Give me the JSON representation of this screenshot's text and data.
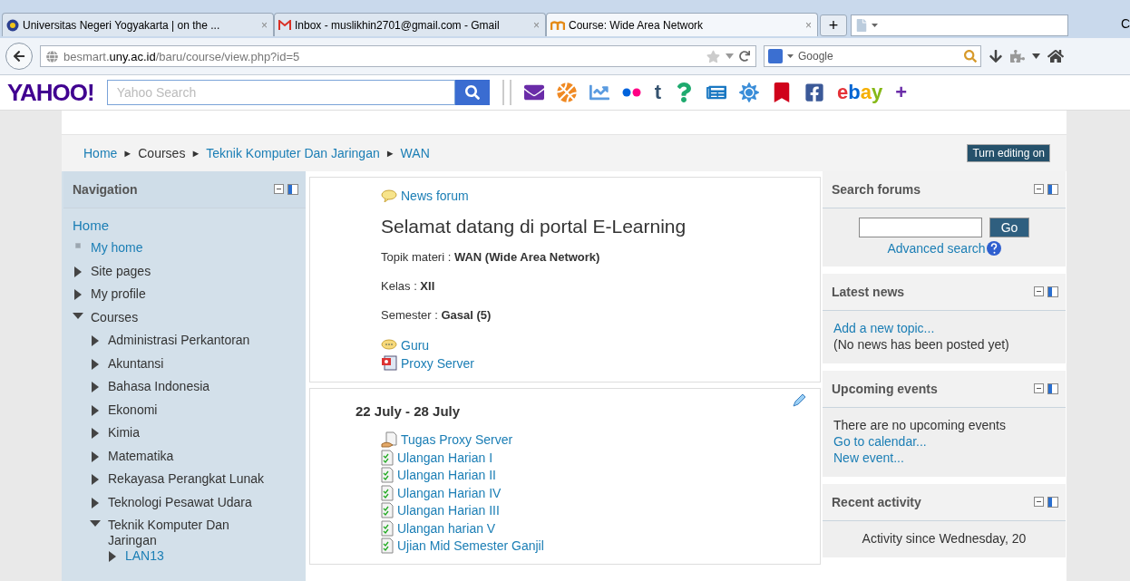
{
  "browser": {
    "tabs": [
      {
        "title": "Universitas Negeri Yogyakarta | on the ...",
        "kind": "seal",
        "close": "×",
        "selected": false
      },
      {
        "title": "Inbox - muslikhin2701@gmail.com - Gmail",
        "kind": "mail",
        "close": "×",
        "selected": false
      },
      {
        "title": "Course: Wide Area Network",
        "kind": "moodle",
        "close": "×",
        "selected": true
      }
    ],
    "new_tab": "+",
    "edge_label": "C",
    "url": {
      "prefix": "besmart.",
      "domain": "uny.ac.id",
      "path": "/baru/course/view.php?id=5"
    },
    "search_engine": "Google"
  },
  "yahoo": {
    "logo": "YAHOO!",
    "placeholder": "Yahoo Search",
    "tumblr": "t",
    "ebay": "ebay",
    "plus": "+"
  },
  "breadcrumb": {
    "separator": "►",
    "items": [
      "Home",
      "Courses",
      "Teknik Komputer Dan Jaringan",
      "WAN"
    ]
  },
  "edit_button": "Turn editing on",
  "navigation": {
    "title": "Navigation",
    "items": [
      {
        "label": "Home",
        "kind": "link"
      },
      {
        "label": "My home",
        "kind": "bullet"
      },
      {
        "label": "Site pages",
        "kind": "branch",
        "expanded": false
      },
      {
        "label": "My profile",
        "kind": "branch",
        "expanded": false
      },
      {
        "label": "Courses",
        "kind": "branch",
        "expanded": true,
        "children": [
          {
            "label": "Administrasi Perkantoran",
            "kind": "branch",
            "expanded": false
          },
          {
            "label": "Akuntansi",
            "kind": "branch",
            "expanded": false
          },
          {
            "label": "Bahasa Indonesia",
            "kind": "branch",
            "expanded": false
          },
          {
            "label": "Ekonomi",
            "kind": "branch",
            "expanded": false
          },
          {
            "label": "Kimia",
            "kind": "branch",
            "expanded": false
          },
          {
            "label": "Matematika",
            "kind": "branch",
            "expanded": false
          },
          {
            "label": "Rekayasa Perangkat Lunak",
            "kind": "branch",
            "expanded": false
          },
          {
            "label": "Teknologi Pesawat Udara",
            "kind": "branch",
            "expanded": false
          },
          {
            "label": "Teknik Komputer Dan Jaringan",
            "kind": "branch",
            "expanded": true,
            "children": [
              {
                "label": "LAN13",
                "kind": "linkbranch",
                "expanded": false
              }
            ]
          }
        ]
      }
    ]
  },
  "sections": [
    {
      "top": [
        {
          "label": "News forum",
          "kind": "forum"
        }
      ],
      "heading": "Selamat datang di portal E-Learning",
      "lines": [
        "Topik materi : **WAN (Wide Area Network)**",
        "Kelas : **XII**",
        "Semester : **Gasal (5)**"
      ],
      "activities": [
        {
          "label": "Guru",
          "kind": "chat"
        },
        {
          "label": "Proxy Server",
          "kind": "slides"
        }
      ]
    },
    {
      "title": "22 July - 28 July",
      "activities": [
        {
          "label": "Tugas Proxy Server",
          "kind": "assignment"
        },
        {
          "label": "Ulangan Harian I",
          "kind": "quiz"
        },
        {
          "label": "Ulangan Harian II",
          "kind": "quiz"
        },
        {
          "label": "Ulangan Harian IV",
          "kind": "quiz"
        },
        {
          "label": "Ulangan Harian III",
          "kind": "quiz"
        },
        {
          "label": "Ulangan harian V",
          "kind": "quiz"
        },
        {
          "label": "Ujian Mid Semester Ganjil",
          "kind": "quiz"
        }
      ]
    }
  ],
  "blocks": [
    {
      "kind": "search",
      "title": "Search forums",
      "button": "Go",
      "link": "Advanced search"
    },
    {
      "kind": "list",
      "title": "Latest news",
      "entries": [
        {
          "text": "Add a new topic...",
          "link": true
        },
        {
          "text": "(No news has been posted yet)",
          "link": false
        }
      ]
    },
    {
      "kind": "list",
      "title": "Upcoming events",
      "entries": [
        {
          "text": "There are no upcoming events",
          "link": false
        },
        {
          "text": "Go to calendar...",
          "link": true
        },
        {
          "text": "New event...",
          "link": true
        }
      ]
    },
    {
      "kind": "center",
      "title": "Recent activity",
      "text": "Activity since Wednesday, 20"
    }
  ]
}
